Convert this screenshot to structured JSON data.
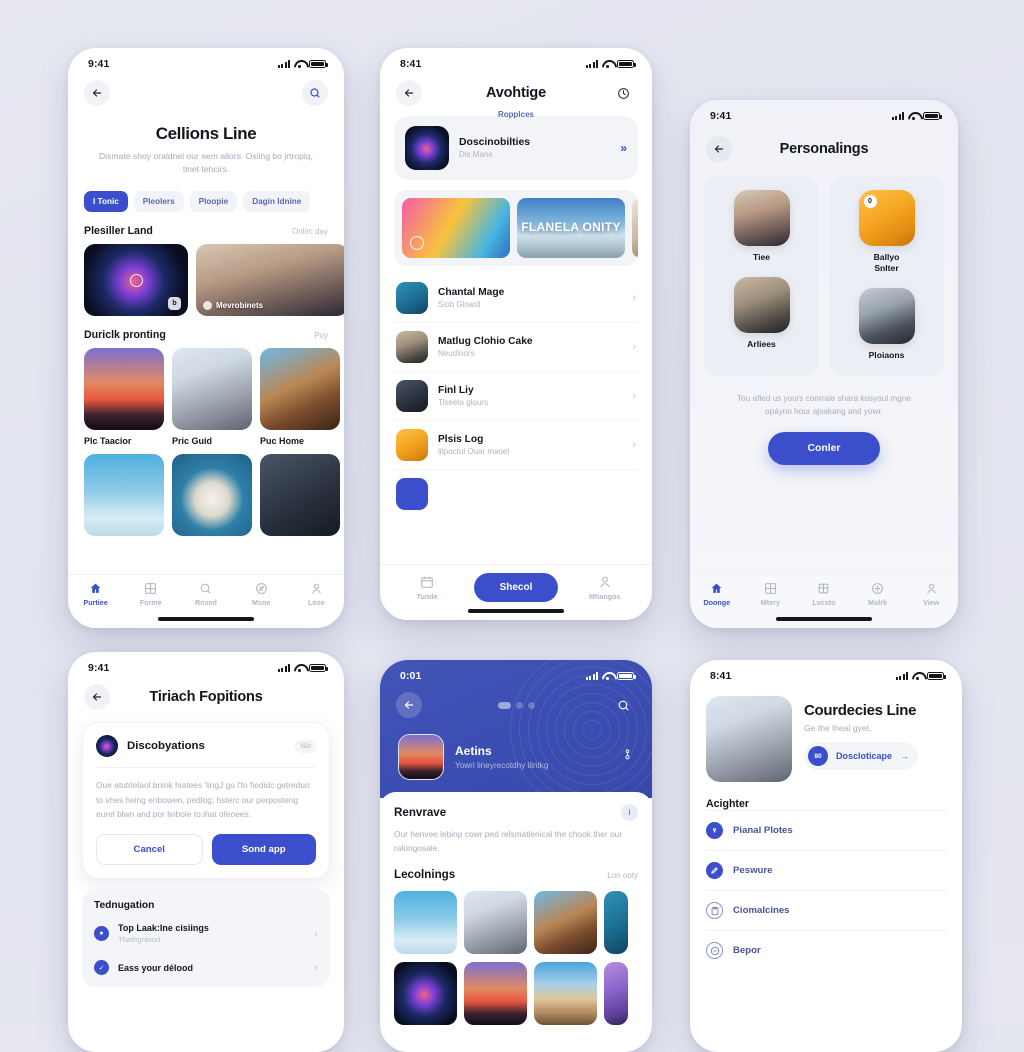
{
  "meta": {
    "status_time": "9:41",
    "status_time_alt": "8:41",
    "status_time_p5": "0:01"
  },
  "colors": {
    "accent": "#3b4fcc",
    "hero_blue": "#4254b6",
    "bg": "#e4e6f0",
    "text": "#14161f",
    "muted": "#a9acbd"
  },
  "screen1": {
    "title": "Cellions Line",
    "subtitle": "Dismate shoy oraldnel our aem allors.\nOxiing bo jrtroplq, tinet tehcirs.",
    "pills": [
      {
        "label": "I Tonic",
        "active": true
      },
      {
        "label": "Pleolers",
        "active": false
      },
      {
        "label": "Ploopie",
        "active": false
      },
      {
        "label": "Dagin Idnine",
        "active": false
      }
    ],
    "section1": {
      "title": "Plesiller Land",
      "action": "Onlirc day"
    },
    "cards": [
      {
        "label": "",
        "badge": "b",
        "img": "im-night"
      },
      {
        "label": "Mevrobinets",
        "badge": "",
        "img": "im-portrait"
      }
    ],
    "section2": {
      "title": "Duriclk pronting",
      "action": "Poy"
    },
    "tiles": [
      {
        "caption": "Plc Taacior",
        "img": "im-dusk"
      },
      {
        "caption": "Pric Guid",
        "img": "im-woman"
      },
      {
        "caption": "Puc Home",
        "img": "im-curly"
      }
    ],
    "tiles2": [
      {
        "caption": "",
        "img": "im-sky"
      },
      {
        "caption": "",
        "img": "im-clock"
      },
      {
        "caption": "",
        "img": "im-dark"
      }
    ],
    "tabs": [
      {
        "label": "Purtiee",
        "icon": "home-icon",
        "active": true
      },
      {
        "label": "Forme",
        "icon": "grid-icon",
        "active": false
      },
      {
        "label": "Rnsed",
        "icon": "search-icon",
        "active": false
      },
      {
        "label": "Msne",
        "icon": "compass-icon",
        "active": false
      },
      {
        "label": "Lose",
        "icon": "person-icon",
        "active": false
      }
    ]
  },
  "screen2": {
    "nav_title": "Avohtige",
    "promo_kicker": "Ropplces",
    "promo": {
      "title": "Doscinobilties",
      "subtitle": "Dis Mane",
      "action": "»"
    },
    "banners": [
      {
        "text": "",
        "img": "im-pink"
      },
      {
        "text": "FLANELA\nONITY",
        "img": "im-ocean"
      },
      {
        "text": "",
        "img": "im-room"
      }
    ],
    "list": [
      {
        "title": "Chantal Mage",
        "subtitle": "Siob Gloard",
        "img": "im-teal"
      },
      {
        "title": "Matlug Clohio Cake",
        "subtitle": "Neudloors",
        "img": "im-street"
      },
      {
        "title": "Finl Liy",
        "subtitle": "Tiseeta glours",
        "img": "im-dark"
      },
      {
        "title": "Plsis Log",
        "subtitle": "litpoctul Ouar maoel",
        "img": "im-food"
      }
    ],
    "tabs": [
      {
        "label": "Tunde",
        "icon": "calendar-icon"
      },
      {
        "label": "Shecol",
        "icon": "cta"
      },
      {
        "label": "Mhangos",
        "icon": "person-icon"
      }
    ]
  },
  "screen3": {
    "nav_title": "Personalings",
    "column_left": [
      {
        "name": "Tiee",
        "img": "im-portrait"
      },
      {
        "name": "Arliees",
        "img": "im-street"
      }
    ],
    "column_right": [
      {
        "name": "Ballyo\nSnlter",
        "img": "im-food"
      },
      {
        "name": "Ploiaons",
        "img": "im-man"
      }
    ],
    "note": "Tou afled us yours conrrale shara kosyoul mgne\nopáyno hour ajsakang and yowr.",
    "cta": "Conler",
    "tabs": [
      {
        "label": "Doonge",
        "icon": "home-icon",
        "active": true
      },
      {
        "label": "Mtery",
        "icon": "grid-icon",
        "active": false
      },
      {
        "label": "Lvcsto",
        "icon": "window-icon",
        "active": false
      },
      {
        "label": "Molrk",
        "icon": "compass-icon",
        "active": false
      },
      {
        "label": "View",
        "icon": "person-icon",
        "active": false
      }
    ]
  },
  "screen4": {
    "nav_title": "Tiriach Fopitions",
    "modal": {
      "title": "Discobyations",
      "tag": "f&b",
      "body": "Oue atutrlelaol bnlok hiatees 'lingJ go l'to fiedidc getreduo to shes heing enbowen, pedlog, hsterc our perposteng eurel blwn and por linbole to:ihat ofeoees.",
      "cancel": "Cancel",
      "confirm": "Sond app"
    },
    "panel": {
      "title": "Tednugation",
      "items": [
        {
          "title": "Top Laak:Ine cisiings",
          "subtitle": "Thathgnbiod"
        },
        {
          "title": "Eass your délood",
          "subtitle": ""
        }
      ]
    }
  },
  "screen5": {
    "hero": {
      "title": "Aetins",
      "subtitle": "Yowri lineyrecotdhy lilntkg"
    },
    "sheet": {
      "title": "Renvrave",
      "body": "Our henvee lebinp cowr ped relsmatlenical the chook ther our ralongosale."
    },
    "section": {
      "title": "Lecolnings",
      "action": "Lon ooty"
    },
    "gallery_row1": [
      "im-sky",
      "im-woman",
      "im-curly",
      "im-teal"
    ],
    "gallery_row2": [
      "im-night",
      "im-dusk",
      "im-bldg",
      "im-violet"
    ]
  },
  "screen6": {
    "profile": {
      "name": "Courdecies Line",
      "subtitle": "Ge the lheal gyet.",
      "pill_avatar": "80",
      "pill_label": "Doscloticape"
    },
    "section": "Acighter",
    "menu": [
      {
        "label": "Pianal Plotes",
        "icon": "compass-icon",
        "style": "solid"
      },
      {
        "label": "Peswure",
        "icon": "edit-icon",
        "style": "solid"
      },
      {
        "label": "Ciomalcines",
        "icon": "clipboard-icon",
        "style": "outline"
      },
      {
        "label": "Bepor",
        "icon": "minus-circle-icon",
        "style": "outline"
      }
    ]
  }
}
